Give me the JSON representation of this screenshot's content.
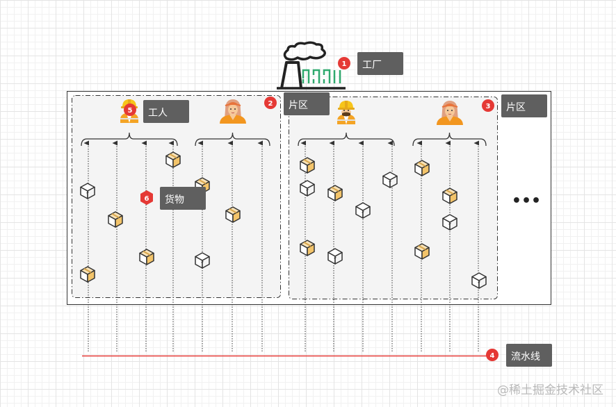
{
  "callouts": {
    "factory": {
      "number": "1",
      "label": "工厂"
    },
    "zone_left": {
      "number": "2",
      "label": "片区"
    },
    "zone_right": {
      "number": "3",
      "label": "片区"
    },
    "pipeline": {
      "number": "4",
      "label": "流水线"
    },
    "worker": {
      "number": "5",
      "label": "工人"
    },
    "cargo": {
      "number": "6",
      "label": "货物"
    }
  },
  "more_indicator": "•••",
  "watermark": "@稀土掘金技术社区",
  "colors": {
    "badge": "#e53935",
    "label_bg": "#5f5f5f",
    "pipeline": "#e53935"
  }
}
